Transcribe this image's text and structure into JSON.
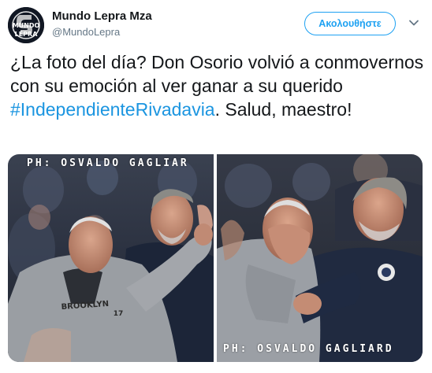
{
  "account": {
    "display_name": "Mundo Lepra Mza",
    "handle": "@MundoLepra",
    "avatar_text_top": "MUNDO",
    "avatar_text_bottom": "LEPRA"
  },
  "actions": {
    "follow_label": "Ακολουθήστε"
  },
  "tweet": {
    "text_before": "¿La foto del día? Don Osorio volvió a conmovernos con su emoción al ver ganar a su querido ",
    "hashtag": "#IndependienteRivadavia",
    "text_after": ". Salud, maestro!"
  },
  "media": {
    "left_credit": "PH: OSVALDO GAGLIAR",
    "right_credit": "PH: OSVALDO GAGLIARD",
    "jacket_text": "BROOKLYN",
    "jacket_number": "17"
  },
  "colors": {
    "accent": "#1da1f2",
    "hashtag": "#1b95e0",
    "secondary_text": "#657786"
  },
  "icons": {
    "chevron": "chevron-down-icon",
    "avatar": "club-logo"
  }
}
